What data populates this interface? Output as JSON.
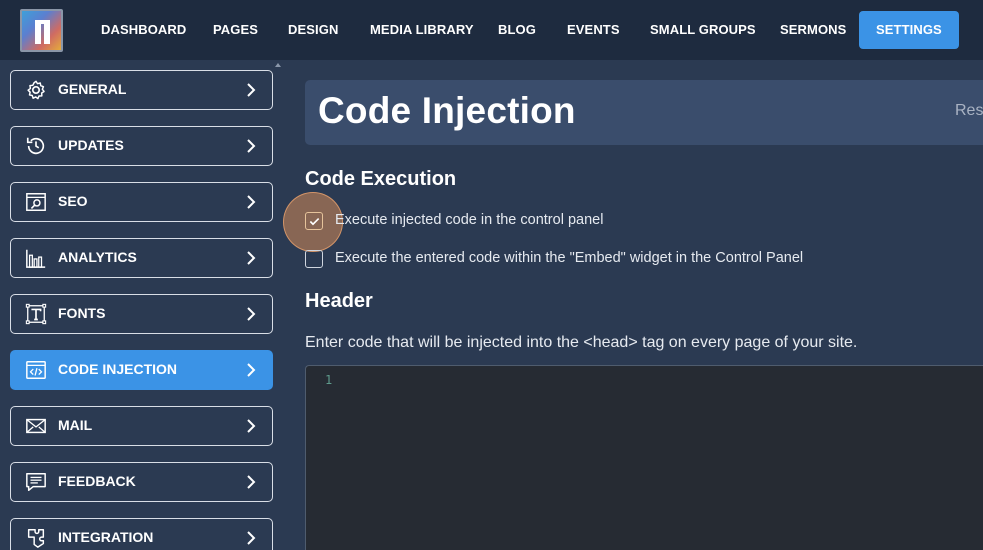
{
  "nav": {
    "items": [
      {
        "label": "DASHBOARD"
      },
      {
        "label": "PAGES"
      },
      {
        "label": "DESIGN"
      },
      {
        "label": "MEDIA LIBRARY"
      },
      {
        "label": "BLOG"
      },
      {
        "label": "EVENTS"
      },
      {
        "label": "SMALL GROUPS"
      },
      {
        "label": "SERMONS"
      },
      {
        "label": "SETTINGS",
        "active": true
      }
    ]
  },
  "sidebar": {
    "items": [
      {
        "label": "GENERAL",
        "icon": "gear-icon"
      },
      {
        "label": "UPDATES",
        "icon": "history-icon"
      },
      {
        "label": "SEO",
        "icon": "seo-search-icon"
      },
      {
        "label": "ANALYTICS",
        "icon": "bar-chart-icon"
      },
      {
        "label": "FONTS",
        "icon": "font-icon"
      },
      {
        "label": "CODE INJECTION",
        "icon": "code-icon",
        "active": true
      },
      {
        "label": "MAIL",
        "icon": "envelope-icon"
      },
      {
        "label": "FEEDBACK",
        "icon": "feedback-icon"
      },
      {
        "label": "INTEGRATION",
        "icon": "puzzle-icon"
      }
    ]
  },
  "main": {
    "title": "Code Injection",
    "reset_label": "Res",
    "code_execution": {
      "heading": "Code Execution",
      "options": [
        {
          "label": "Execute injected code in the control panel",
          "checked": true
        },
        {
          "label": "Execute the entered code within the \"Embed\" widget in the Control Panel",
          "checked": false
        }
      ]
    },
    "header": {
      "heading": "Header",
      "help": "Enter code that will be injected into the <head> tag on every page of your site.",
      "editor_line_number": "1"
    }
  },
  "colors": {
    "accent": "#3b93e6",
    "topbar": "#1e2b3f",
    "background": "#2b3a52",
    "title_bar": "#3a4d6c",
    "editor": "#262b33"
  }
}
